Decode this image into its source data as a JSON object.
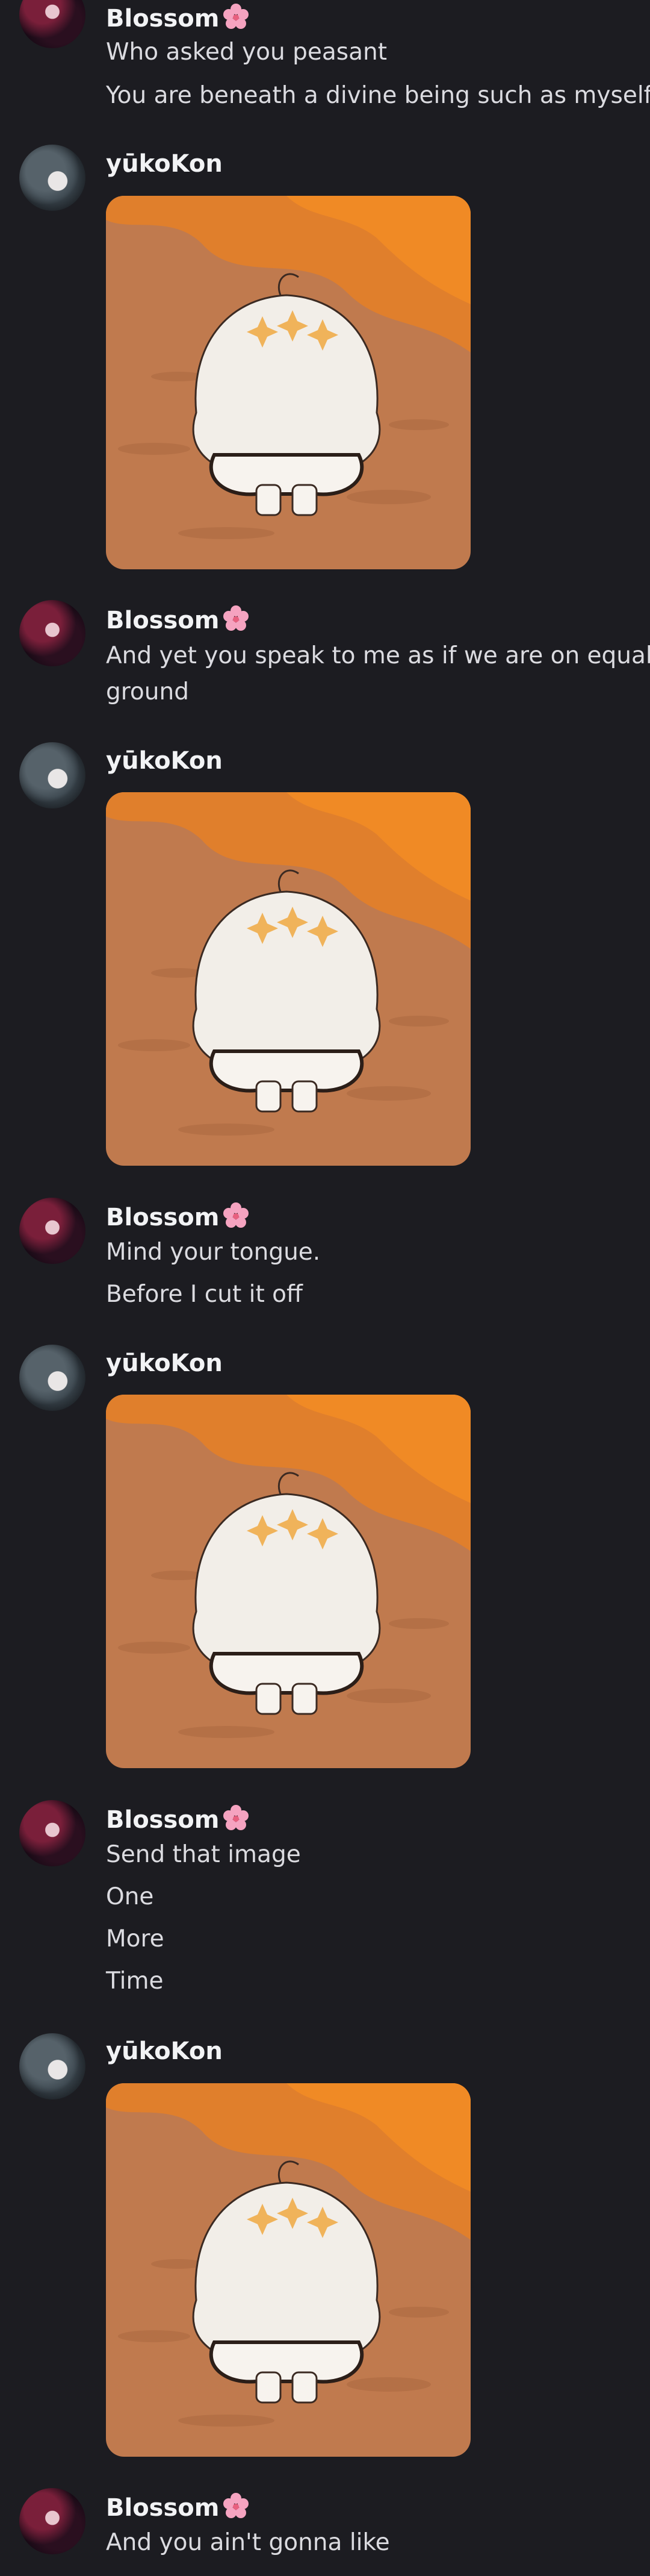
{
  "users": {
    "blossom": {
      "name": "Blossom",
      "emoji": "flower-icon"
    },
    "yuko": {
      "name": "yūkoKon"
    }
  },
  "messages": [
    {
      "user": "blossom",
      "lines": [
        "Who asked you peasant",
        "You are beneath a divine being such as myself"
      ]
    },
    {
      "user": "yuko",
      "image": "chibi-character-image"
    },
    {
      "user": "blossom",
      "lines": [
        "And yet you speak to me as if we are on equal",
        "ground"
      ]
    },
    {
      "user": "yuko",
      "image": "chibi-character-image"
    },
    {
      "user": "blossom",
      "lines": [
        "Mind your tongue.",
        "Before I cut it off"
      ]
    },
    {
      "user": "yuko",
      "image": "chibi-character-image"
    },
    {
      "user": "blossom",
      "lines": [
        "Send that image",
        "One",
        "More",
        "Time"
      ]
    },
    {
      "user": "yuko",
      "image": "chibi-character-image"
    },
    {
      "user": "blossom",
      "lines": [
        "And you ain't gonna like"
      ]
    }
  ]
}
